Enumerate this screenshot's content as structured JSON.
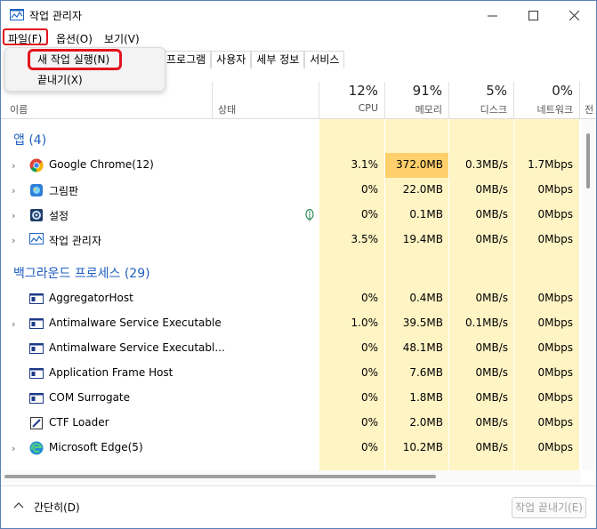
{
  "window": {
    "title": "작업 관리자"
  },
  "menu": {
    "file": "파일(F)",
    "options": "옵션(O)",
    "view": "보기(V)"
  },
  "file_menu": {
    "new_task": "새 작업 실행(N)",
    "exit": "끝내기(X)"
  },
  "tabs": [
    "프로그램",
    "사용자",
    "세부 정보",
    "서비스"
  ],
  "header": {
    "name": "이름",
    "status": "상태",
    "cpu": {
      "pct": "12%",
      "label": "CPU"
    },
    "memory": {
      "pct": "91%",
      "label": "메모리"
    },
    "disk": {
      "pct": "5%",
      "label": "디스크"
    },
    "network": {
      "pct": "0%",
      "label": "네트워크"
    },
    "power_partial": "전"
  },
  "groups": {
    "apps": "앱 (4)",
    "background": "백그라운드 프로세스 (29)"
  },
  "apps": [
    {
      "name": "Google Chrome(12)",
      "icon": "chrome-icon",
      "cpu": "3.1%",
      "mem": "372.0MB",
      "disk": "0.3MB/s",
      "net": "1.7Mbps",
      "expand": true
    },
    {
      "name": "그림판",
      "icon": "paint-icon",
      "cpu": "0%",
      "mem": "22.0MB",
      "disk": "0MB/s",
      "net": "0Mbps",
      "expand": true
    },
    {
      "name": "설정",
      "icon": "settings-icon",
      "cpu": "0%",
      "mem": "0.1MB",
      "disk": "0MB/s",
      "net": "0Mbps",
      "expand": true
    },
    {
      "name": "작업 관리자",
      "icon": "taskmgr-icon",
      "cpu": "3.5%",
      "mem": "19.4MB",
      "disk": "0MB/s",
      "net": "0Mbps",
      "expand": true
    }
  ],
  "background": [
    {
      "name": "AggregatorHost",
      "cpu": "0%",
      "mem": "0.4MB",
      "disk": "0MB/s",
      "net": "0Mbps",
      "expand": false
    },
    {
      "name": "Antimalware Service Executable",
      "cpu": "1.0%",
      "mem": "39.5MB",
      "disk": "0.1MB/s",
      "net": "0Mbps",
      "expand": true
    },
    {
      "name": "Antimalware Service Executabl...",
      "cpu": "0%",
      "mem": "48.1MB",
      "disk": "0MB/s",
      "net": "0Mbps",
      "expand": false
    },
    {
      "name": "Application Frame Host",
      "cpu": "0%",
      "mem": "7.6MB",
      "disk": "0MB/s",
      "net": "0Mbps",
      "expand": false
    },
    {
      "name": "COM Surrogate",
      "cpu": "0%",
      "mem": "1.8MB",
      "disk": "0MB/s",
      "net": "0Mbps",
      "expand": false
    },
    {
      "name": "CTF Loader",
      "cpu": "0%",
      "mem": "2.0MB",
      "disk": "0MB/s",
      "net": "0Mbps",
      "expand": false
    },
    {
      "name": "Microsoft Edge(5)",
      "cpu": "0%",
      "mem": "10.2MB",
      "disk": "0MB/s",
      "net": "0Mbps",
      "expand": true
    }
  ],
  "footer": {
    "fewer_details": "간단히(D)",
    "end_task": "작업 끝내기(E)"
  },
  "colors": {
    "accent_group": "#1f5fbf",
    "column_bg": "#fff4c4",
    "memory_highlight": "#ffd06b",
    "annotation_red": "#e3141f"
  }
}
